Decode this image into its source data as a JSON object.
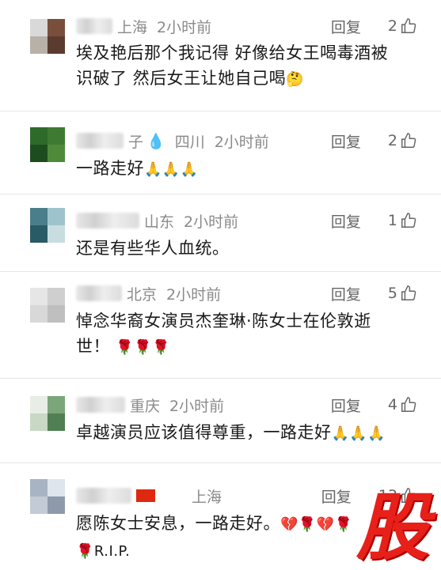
{
  "comments": [
    {
      "location": "上海",
      "time": "2小时前",
      "reply_label": "回复",
      "likes": "2",
      "text_line1": "埃及艳后那个我记得 好像给女王喝毒酒被",
      "text_line2": "识破了 然后女王让她自己喝",
      "emoji": "🤔",
      "avatar_colors": [
        "#d9d9d9",
        "#7a4e3c",
        "#b9b0a8",
        "#5b3b2e"
      ]
    },
    {
      "name_tail": "子",
      "location": "四川",
      "time": "2小时前",
      "reply_label": "回复",
      "likes": "2",
      "text_line1": "一路走好",
      "emoji": "🙏🙏🙏",
      "avatar_colors": [
        "#2e6a2a",
        "#3f7a32",
        "#1d4d1f",
        "#4f8a3a"
      ]
    },
    {
      "location": "山东",
      "time": "2小时前",
      "reply_label": "回复",
      "likes": "1",
      "text_line1": "还是有些华人血统。",
      "avatar_colors": [
        "#4a7e8a",
        "#9fc3cc",
        "#2a5a66",
        "#c9dde0"
      ]
    },
    {
      "location": "北京",
      "time": "2小时前",
      "reply_label": "回复",
      "likes": "5",
      "text_line1": "悼念华裔女演员杰奎琳·陈女士在伦敦逝",
      "text_line2": "世！",
      "emoji": "🌹🌹🌹",
      "avatar_colors": [
        "#e6e6e6",
        "#cfcfcf",
        "#d8d8d8",
        "#bfbfbf"
      ]
    },
    {
      "location": "重庆",
      "time": "2小时前",
      "reply_label": "回复",
      "likes": "4",
      "text_line1": "卓越演员应该值得尊重，一路走好",
      "emoji": "🙏🙏🙏",
      "avatar_colors": [
        "#e8ede6",
        "#7aa67a",
        "#c9d8c4",
        "#4f7f52"
      ]
    },
    {
      "location": "上海",
      "time": "2小时前",
      "reply_label": "回复",
      "likes": "13",
      "text_line1": "愿陈女士安息，一路走好。",
      "emoji": "💔🌹💔🌹",
      "text_line2_emoji": "🌹",
      "text_line2": "R.I.P.",
      "avatar_colors": [
        "#a8b4c4",
        "#dfe5ec",
        "#c3cbd6",
        "#8e9aab"
      ]
    }
  ],
  "watermark": "股",
  "accent_color": "#e8201a"
}
